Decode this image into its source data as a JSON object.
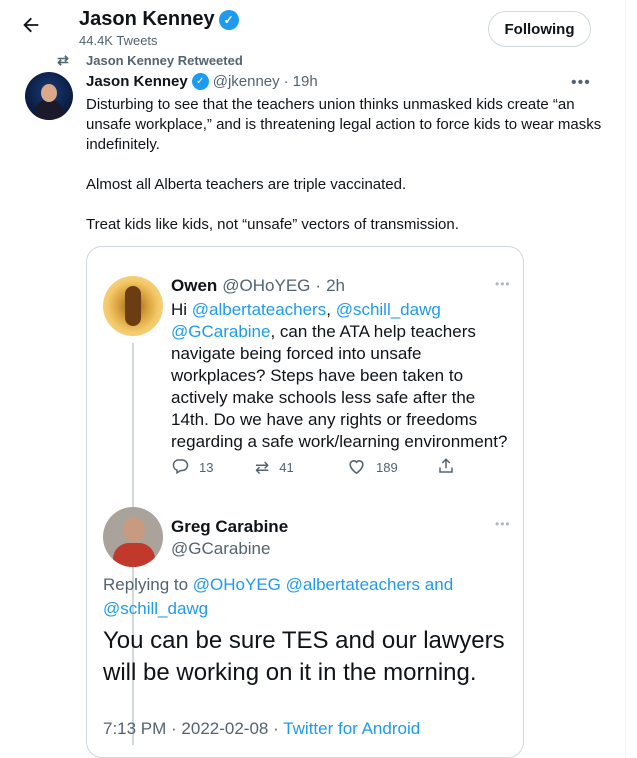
{
  "header": {
    "back_icon": "arrow-left-icon",
    "name": "Jason Kenney",
    "tweet_count": "44.4K Tweets",
    "follow_label": "Following"
  },
  "retweet": {
    "icon": "retweet-icon",
    "label": "Jason Kenney Retweeted"
  },
  "tweet": {
    "name": "Jason Kenney",
    "handle": "@jkenney",
    "separator": "·",
    "time": "19h",
    "more": "•••",
    "paragraphs": [
      "Disturbing to see that the teachers union thinks unmasked kids create “an unsafe workplace,” and is threatening legal action to force kids to wear masks indefinitely.",
      "Almost all Alberta teachers are triple vaccinated.",
      "Treat kids like kids, not “unsafe” vectors of transmission."
    ]
  },
  "quoted": {
    "owen": {
      "name": "Owen",
      "handle": "@OHoYEG",
      "separator": "·",
      "time": "2h",
      "more": "•••",
      "text_pre": "Hi ",
      "mention1": "@albertateachers",
      "comma": ", ",
      "mention2": "@schill_dawg",
      "mention3": "@GCarabine",
      "text_post": ", can the ATA help teachers navigate being forced into unsafe workplaces? Steps have been taken to actively make schools less safe after the 14th. Do we have any rights or freedoms regarding a safe work/learning environment?",
      "replies": "13",
      "retweets": "41",
      "likes": "189"
    },
    "greg": {
      "name": "Greg Carabine",
      "handle": "@GCarabine",
      "more": "•••",
      "replying_prefix": "Replying to ",
      "replying_to": "@OHoYEG @albertateachers and @schill_dawg",
      "text": "You can be sure TES and our lawyers will be working on it in the morning.",
      "time": "7:13 PM · 2022-02-08 · ",
      "source": "Twitter for Android"
    }
  }
}
